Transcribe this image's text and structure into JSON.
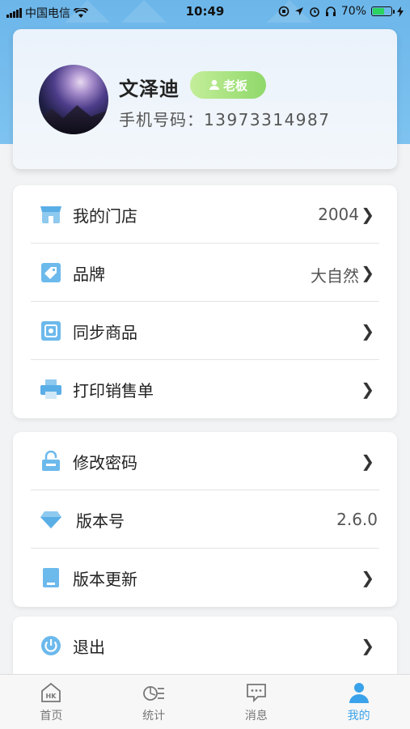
{
  "status_bar": {
    "carrier": "中国电信",
    "time": "10:49",
    "battery_percent": "70%",
    "battery_level": 0.7
  },
  "profile": {
    "name": "文泽迪",
    "role": "老板",
    "phone_label": "手机号码：",
    "phone_number": "13973314987"
  },
  "menu_group1": [
    {
      "label": "我的门店",
      "value": "2004",
      "icon": "store-icon"
    },
    {
      "label": "品牌",
      "value": "大自然",
      "icon": "tag-icon"
    },
    {
      "label": "同步商品",
      "value": "",
      "icon": "sync-icon"
    },
    {
      "label": "打印销售单",
      "value": "",
      "icon": "printer-icon"
    }
  ],
  "menu_group2": [
    {
      "label": "修改密码",
      "value": "",
      "icon": "lock-icon"
    },
    {
      "label": "版本号",
      "value": "2.6.0",
      "icon": "diamond-icon"
    },
    {
      "label": "版本更新",
      "value": "",
      "icon": "book-icon"
    }
  ],
  "menu_group3": [
    {
      "label": "退出",
      "value": "",
      "icon": "power-icon"
    }
  ],
  "tabbar": {
    "tabs": [
      {
        "label": "首页",
        "icon": "home-icon",
        "active": false
      },
      {
        "label": "统计",
        "icon": "statistics-icon",
        "active": false
      },
      {
        "label": "消息",
        "icon": "message-icon",
        "active": false
      },
      {
        "label": "我的",
        "icon": "person-icon",
        "active": true
      }
    ]
  },
  "colors": {
    "header_blue": "#6cb6ea",
    "accent_blue": "#3aa2ea",
    "badge_green": "#8fd86a"
  }
}
